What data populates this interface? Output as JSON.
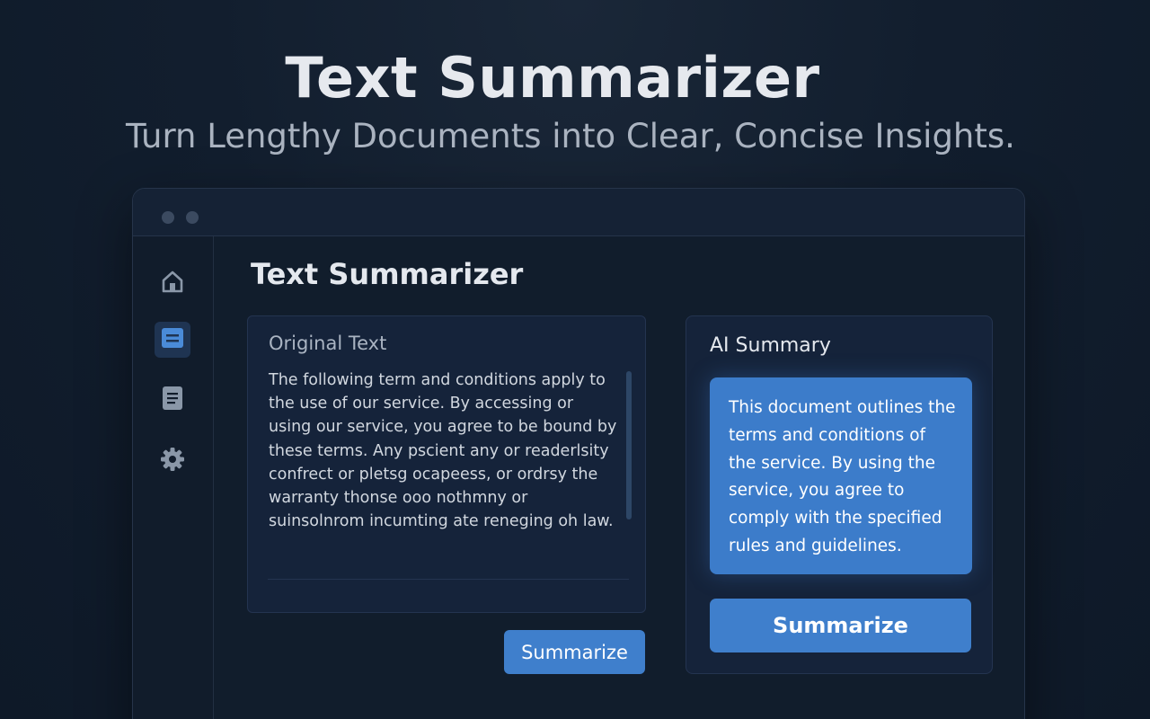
{
  "hero": {
    "title": "Text Summarizer",
    "subtitle": "Turn Lengthy Documents into Clear, Concise Insights."
  },
  "app": {
    "title": "Text Summarizer",
    "sidebar": [
      {
        "icon": "home-icon",
        "active": false
      },
      {
        "icon": "summary-icon",
        "active": true
      },
      {
        "icon": "document-icon",
        "active": false
      },
      {
        "icon": "gear-icon",
        "active": false
      }
    ],
    "original": {
      "label": "Original Text",
      "text": "The following term and conditions apply to the use of our service. By accessing or using our service, you agree to be bound by these terms. Any pscient any or readerlsity confrect or pletsg ocapeess, or ordrsy the warranty thonse ooo nothmny or suinsolnrom incumting ate reneging oh law.",
      "button": "Summarize"
    },
    "summary": {
      "label": "AI Summary",
      "text": "This document outlines the terms and conditions of the service. By using the service, you agree to comply with the specified rules and guidelines.",
      "button": "Summarize"
    }
  },
  "colors": {
    "accent": "#3f7fcc",
    "background": "#0f1b2b",
    "panel": "#15233a"
  }
}
